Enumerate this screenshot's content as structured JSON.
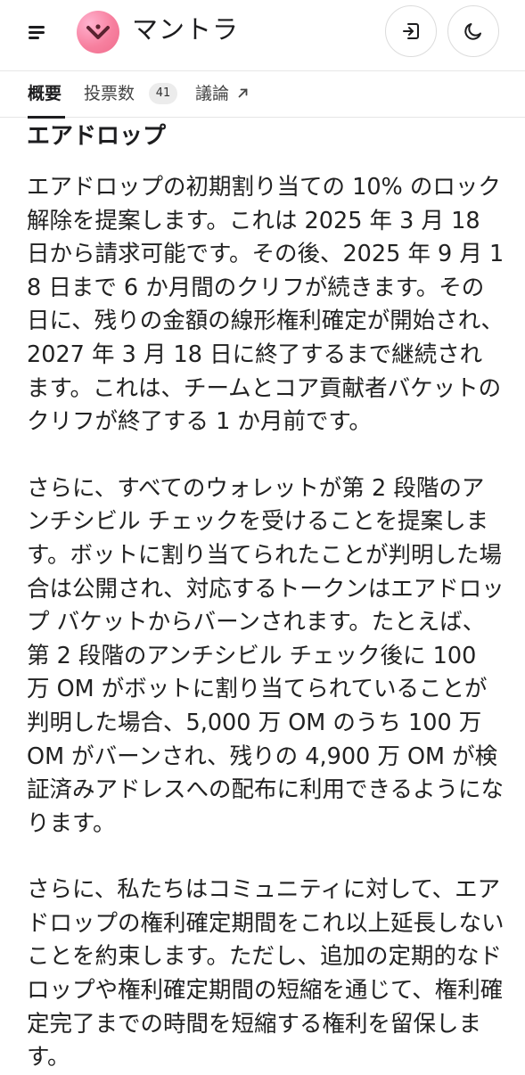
{
  "header": {
    "app_title": "マントラ",
    "icons": {
      "menu": "hamburger-menu-icon",
      "logo": "mantra-logo-icon",
      "export": "sign-in-icon",
      "theme": "moon-icon"
    },
    "colors": {
      "logo_gradient_start": "#ffb2cf",
      "logo_gradient_end": "#ef6c8c"
    }
  },
  "tabs": {
    "overview": "概要",
    "votes": "投票数",
    "votes_count": "41",
    "discussion": "議論",
    "discussion_icon": "external-arrow-icon"
  },
  "content": {
    "heading": "エアドロップ",
    "paragraphs": [
      "エアドロップの初期割り当ての 10% のロック解除を提案します。これは 2025 年 3 月 18 日から請求可能です。その後、2025 年 9 月 18 日まで 6 か月間のクリフが続きます。その日に、残りの金額の線形権利確定が開始され、2027 年 3 月 18 日に終了するまで継続されます。これは、チームとコア貢献者バケットのクリフが終了する 1 か月前です。",
      "さらに、すべてのウォレットが第 2 段階のアンチシビル チェックを受けることを提案します。ボットに割り当てられたことが判明した場合は公開され、対応するトークンはエアドロップ バケットからバーンされます。たとえば、第 2 段階のアンチシビル チェック後に 100 万 OM がボットに割り当てられていることが判明した場合、5,000 万 OM のうち 100 万 OM がバーンされ、残りの 4,900 万 OM が検証済みアドレスへの配布に利用できるようになります。",
      "さらに、私たちはコミュニティに対して、エアドロップの権利確定期間をこれ以上延長しないことを約束します。ただし、追加の定期的なドロップや権利確定期間の短縮を通じて、権利確定完了までの時間を短縮する権利を留保します。"
    ]
  }
}
